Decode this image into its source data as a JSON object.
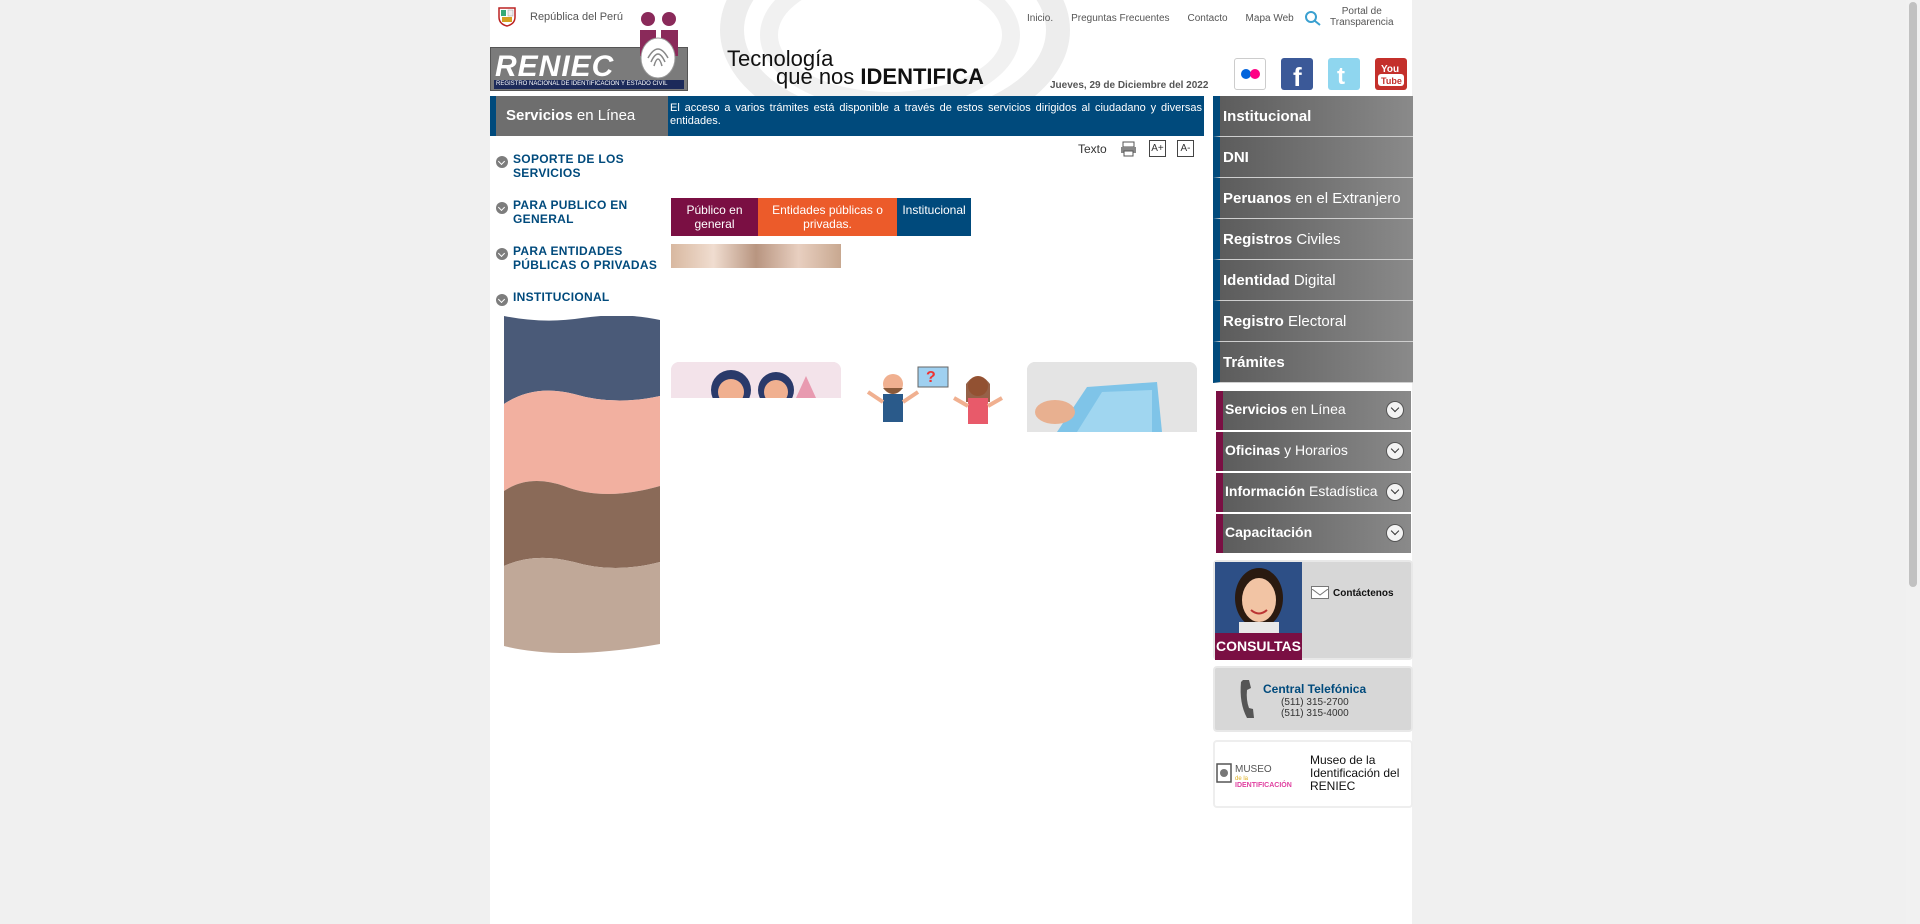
{
  "header": {
    "republica": "República del Perú",
    "logo_text": "RENIEC",
    "logo_subtitle": "REGISTRO NACIONAL DE IDENTIFICACIÓN Y ESTADO CIVIL",
    "tagline_line1": "Tecnología",
    "tagline_line2_prefix": "que nos ",
    "tagline_line2_bold": "IDENTIFICA",
    "date": "Jueves, 29 de Diciembre del 2022",
    "links": [
      "Inicio.",
      "Preguntas Frecuentes",
      "Contacto",
      "Mapa Web"
    ],
    "transparencia": [
      "Portal de",
      "Transparencia"
    ],
    "social": [
      "flickr-icon",
      "facebook-icon",
      "twitter-icon",
      "youtube-icon"
    ]
  },
  "services": {
    "title_bold": "Servicios",
    "title_rest": " en Línea",
    "description": "El acceso a varios trámites está disponible a través de estos servicios dirigidos al ciudadano y diversas entidades."
  },
  "left_menu": [
    "SOPORTE DE LOS SERVICIOS",
    "PARA PUBLICO EN GENERAL",
    "PARA ENTIDADES PÚBLICAS O PRIVADAS",
    "INSTITUCIONAL"
  ],
  "tools": {
    "texto": "Texto",
    "increase": "A+",
    "decrease": "A-"
  },
  "tabs": [
    "Público en general",
    "Entidades públicas o privadas.",
    "Institucional"
  ],
  "right_nav": [
    {
      "bold": "Institucional",
      "rest": ""
    },
    {
      "bold": "DNI",
      "rest": ""
    },
    {
      "bold": "Peruanos",
      "rest": " en el Extranjero"
    },
    {
      "bold": "Registros",
      "rest": " Civiles"
    },
    {
      "bold": "Identidad",
      "rest": " Digital"
    },
    {
      "bold": "Registro",
      "rest": " Electoral"
    },
    {
      "bold": "Trámites",
      "rest": ""
    }
  ],
  "right_sub": [
    {
      "bold": "Servicios",
      "rest": " en Línea"
    },
    {
      "bold": "Oficinas",
      "rest": " y Horarios"
    },
    {
      "bold": "Información",
      "rest": " Estadística"
    },
    {
      "bold": "Capacitación",
      "rest": ""
    }
  ],
  "consultas": {
    "label": "CONSULTAS",
    "contact": "Contáctenos"
  },
  "phone": {
    "title": "Central Telefónica",
    "n1": "(511) 315-2700",
    "n2": "(511) 315-4000"
  },
  "museo": {
    "logo_line1": "MUSEO",
    "logo_line2": "de la",
    "logo_line3": "IDENTIFICACIÓN",
    "text": "Museo de la Identificación del RENIEC"
  },
  "colors": {
    "brand_blue": "#004a7c",
    "brand_maroon": "#7a0f43",
    "brand_orange": "#ec5b2a"
  }
}
